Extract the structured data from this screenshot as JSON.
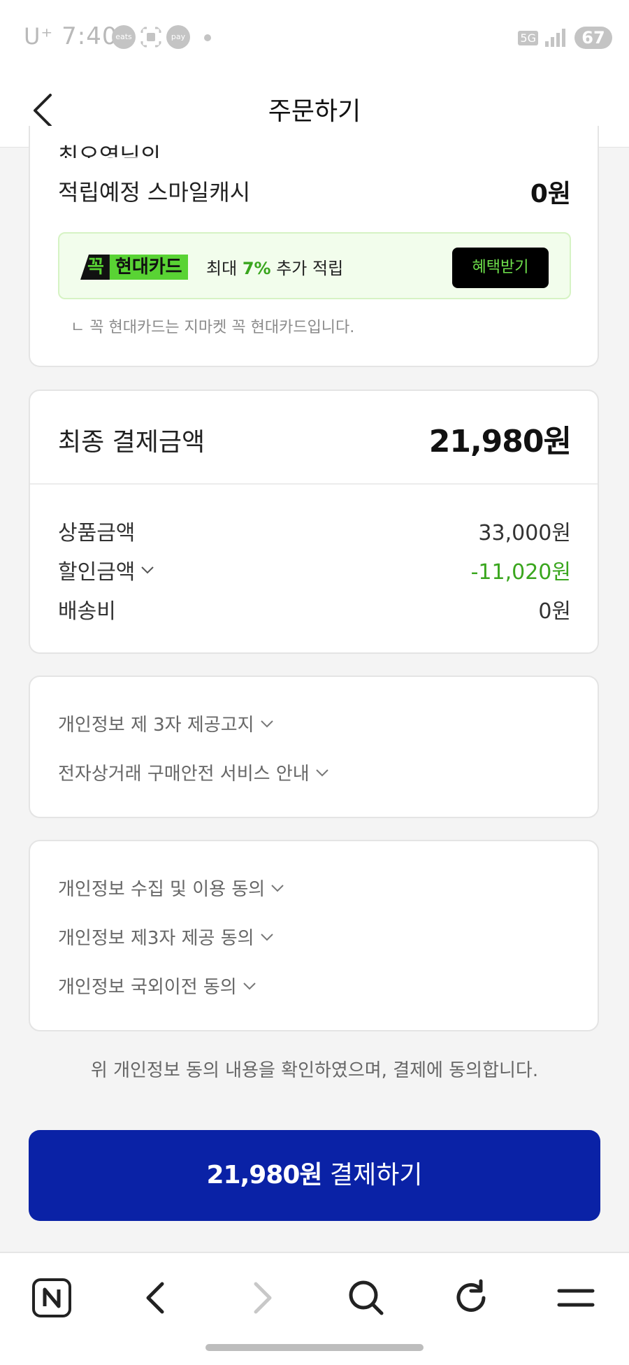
{
  "status_bar": {
    "carrier": "U⁺",
    "time": "7:40",
    "app_icons": [
      "eats",
      "pay"
    ],
    "network": "5G",
    "battery": "67"
  },
  "header": {
    "title": "주문하기",
    "back_icon": "chevron-left-icon"
  },
  "reward": {
    "name_partial": "최오영님의",
    "label": "적립예정 스마일캐시",
    "value": "0원"
  },
  "promo": {
    "brand_mark": "꼭",
    "brand_name": "현대카드",
    "text_prefix": "최대",
    "percent": "7%",
    "text_suffix": "추가 적립",
    "button": "혜택받기",
    "note": "ㄴ 꼭 현대카드는 지마켓 꼭 현대카드입니다."
  },
  "summary": {
    "final_label": "최종 결제금액",
    "final_value": "21,980원",
    "rows": [
      {
        "label": "상품금액",
        "value": "33,000원"
      },
      {
        "label": "할인금액",
        "value": "-11,020원"
      },
      {
        "label": "배송비",
        "value": "0원"
      }
    ],
    "discount_color": "#3aa61e"
  },
  "notices": [
    "개인정보 제 3자 제공고지",
    "전자상거래 구매안전 서비스 안내"
  ],
  "agreements": [
    "개인정보 수집 및 이용 동의",
    "개인정보 제3자 제공 동의",
    "개인정보 국외이전 동의"
  ],
  "consent_text": "위 개인정보 동의 내용을 확인하였으며, 결제에 동의합니다.",
  "pay_button": {
    "amount": "21,980원",
    "label": "결제하기",
    "color": "#0a22a6"
  },
  "bottom_nav": {
    "icons": [
      "naver-n-icon",
      "back-arrow-icon",
      "forward-arrow-icon",
      "search-icon",
      "refresh-icon",
      "menu-icon"
    ]
  }
}
